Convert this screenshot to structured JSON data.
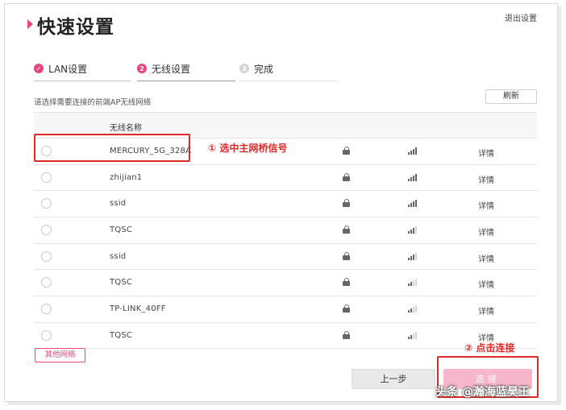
{
  "header": {
    "title": "快速设置",
    "exit_label": "退出设置"
  },
  "steps": [
    {
      "label": "LAN设置",
      "state": "done",
      "icon": "check-icon"
    },
    {
      "label": "无线设置",
      "state": "current",
      "number": "2"
    },
    {
      "label": "完成",
      "state": "todo",
      "number": "3"
    }
  ],
  "hint": "请选择需要连接的前端AP无线网络",
  "refresh_label": "刷新",
  "table": {
    "column_name": "无线名称",
    "rows": [
      {
        "ssid": "MERCURY_5G_328A",
        "signal": 3,
        "details": "详情"
      },
      {
        "ssid": "zhijian1",
        "signal": 3,
        "details": "详情"
      },
      {
        "ssid": "ssid",
        "signal": 3,
        "details": "详情"
      },
      {
        "ssid": "TQSC",
        "signal": 2,
        "details": "详情"
      },
      {
        "ssid": "ssid",
        "signal": 2,
        "details": "详情"
      },
      {
        "ssid": "TQSC",
        "signal": 1,
        "details": "详情"
      },
      {
        "ssid": "TP-LINK_40FF",
        "signal": 1,
        "details": "详情"
      },
      {
        "ssid": "TQSC",
        "signal": 1,
        "details": "详情"
      }
    ]
  },
  "annotations": {
    "select_bridge": "① 选中主网桥信号",
    "click_connect": "② 点击连接"
  },
  "footer": {
    "other_network_label": "其他网络",
    "prev_label": "上一步",
    "connect_label": "连接"
  },
  "watermark": "头条 @瀚海蓝昊王",
  "colors": {
    "accent": "#e8457b",
    "annotation": "#e02828",
    "connect_disabled": "#f7b6cb"
  }
}
